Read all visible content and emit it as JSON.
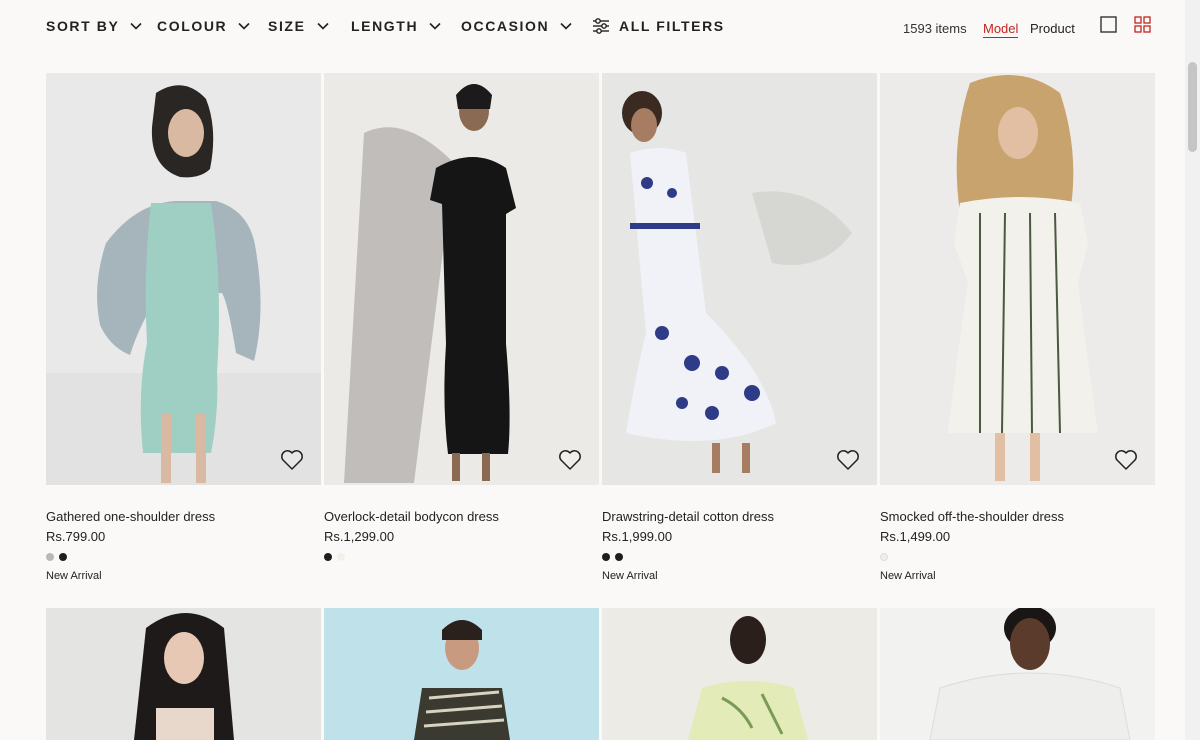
{
  "filters": {
    "sort_by": "SORT BY",
    "colour": "COLOUR",
    "size": "SIZE",
    "length": "LENGTH",
    "occasion": "OCCASION",
    "all_filters": "ALL FILTERS"
  },
  "results": {
    "count": "1593 items",
    "view_model": "Model",
    "view_product": "Product"
  },
  "colors": {
    "accent": "#c2231f",
    "text": "#222222",
    "background": "#faf9f8"
  },
  "products": [
    {
      "title": "Gathered one-shoulder dress",
      "price": "Rs.799.00",
      "swatches": [
        "#b9b9b9",
        "#1e1e1e"
      ],
      "badge": "New Arrival"
    },
    {
      "title": "Overlock-detail bodycon dress",
      "price": "Rs.1,299.00",
      "swatches": [
        "#1e1e1e",
        "#f3efe9"
      ],
      "badge": ""
    },
    {
      "title": "Drawstring-detail cotton dress",
      "price": "Rs.1,999.00",
      "swatches": [
        "#1e1e1e",
        "#1e1e1e"
      ],
      "badge": "New Arrival"
    },
    {
      "title": "Smocked off-the-shoulder dress",
      "price": "Rs.1,499.00",
      "swatches": [
        "#f0ede8"
      ],
      "badge": "New Arrival"
    }
  ]
}
